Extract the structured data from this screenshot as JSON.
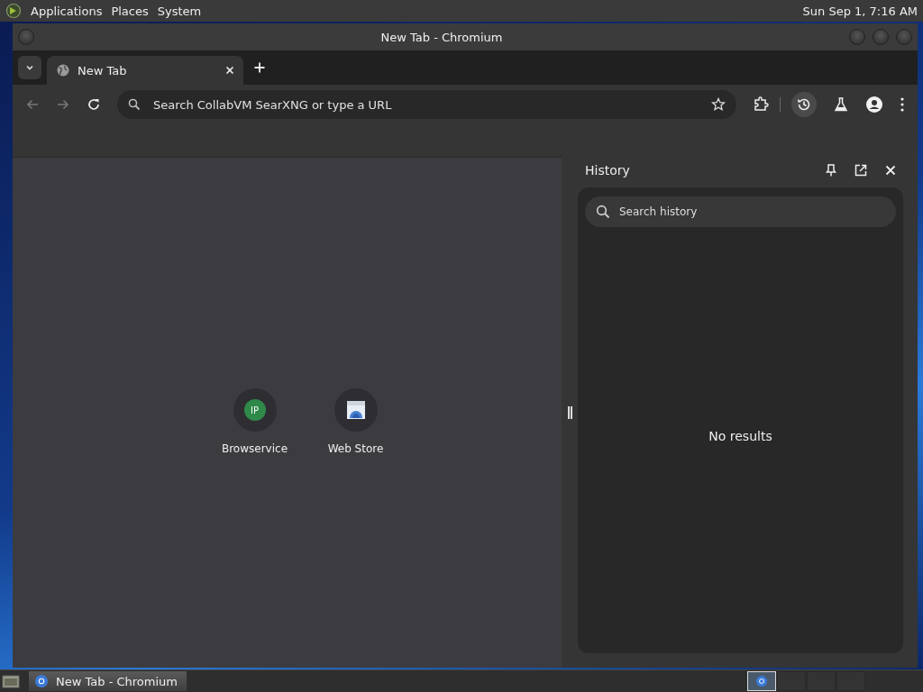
{
  "top_panel": {
    "menus": [
      "Applications",
      "Places",
      "System"
    ],
    "clock": "Sun Sep  1,  7:16 AM"
  },
  "window": {
    "title": "New Tab - Chromium"
  },
  "tabs": [
    {
      "label": "New Tab",
      "selected": true
    }
  ],
  "omnibox": {
    "placeholder": "Search CollabVM SearXNG or type a URL"
  },
  "toolbar": {
    "history_active": true
  },
  "shortcuts": [
    {
      "label": "Browservice",
      "kind": "letters",
      "icon_text": "IP"
    },
    {
      "label": "Web Store",
      "kind": "store"
    }
  ],
  "side_panel": {
    "title": "History",
    "search": {
      "placeholder": "Search history"
    },
    "empty_message": "No results"
  },
  "taskbar": {
    "tasks": [
      {
        "label": "New Tab - Chromium",
        "selected": true
      }
    ],
    "workspaces": [
      {
        "selected": true
      },
      {
        "selected": false
      },
      {
        "selected": false
      },
      {
        "selected": false
      }
    ]
  }
}
